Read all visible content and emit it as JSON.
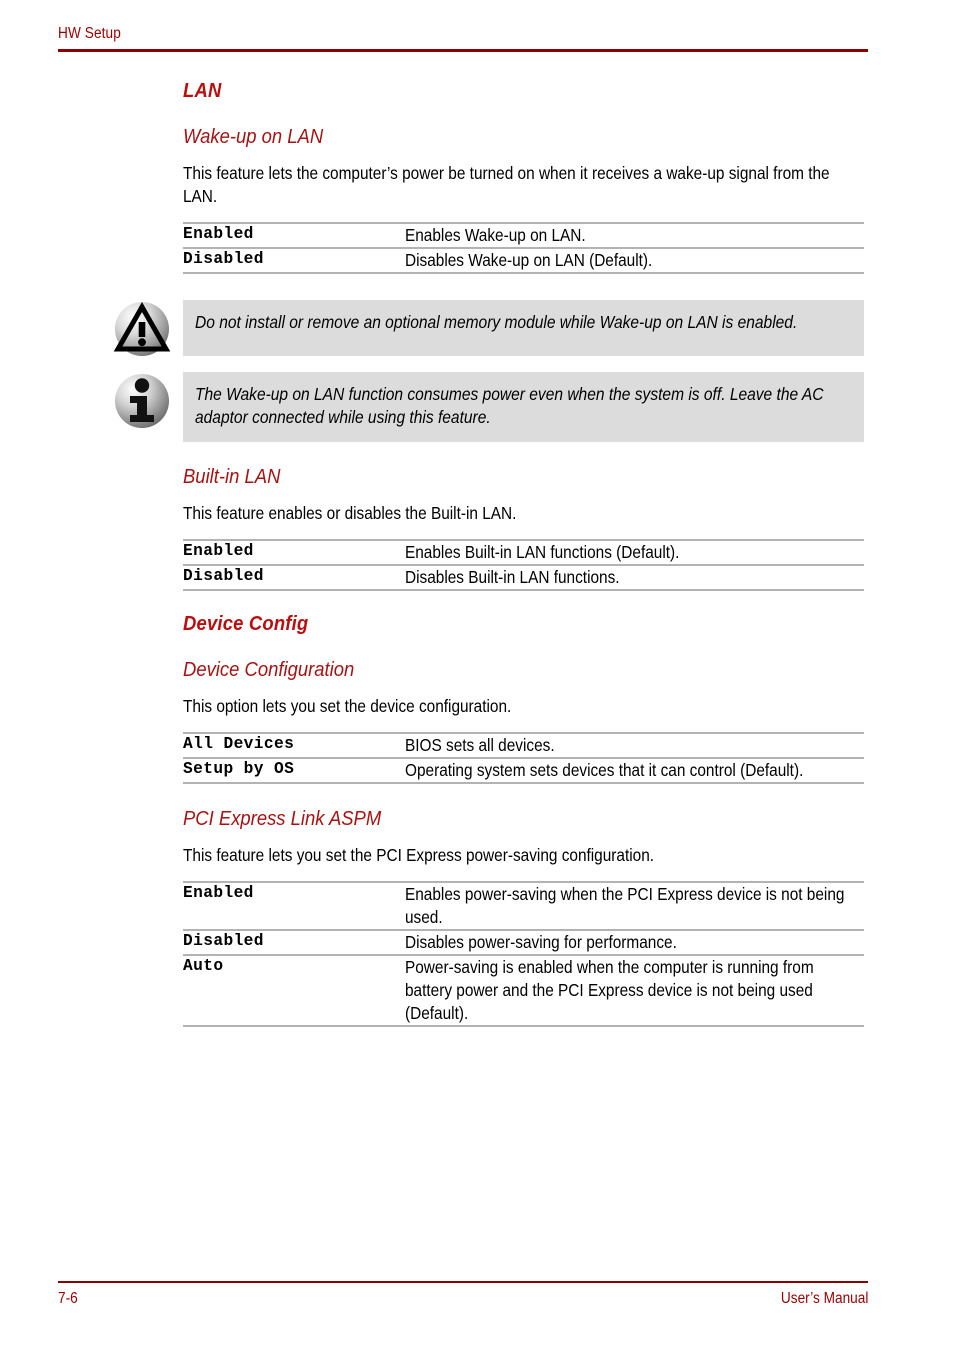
{
  "header": {
    "title": "HW Setup"
  },
  "footer": {
    "page_number": "7-6",
    "manual_label": "User’s Manual"
  },
  "colors": {
    "heading_red": "#bb0d0d",
    "subheading_red": "#a81212",
    "header_rule_red": "#8b0000",
    "running_head_red": "#990000",
    "note_background": "#dcdcdc",
    "table_rule_gray": "#b3b3b3"
  },
  "sections": [
    {
      "id": "lan",
      "heading": "LAN",
      "subsections": [
        {
          "id": "wake-up-on-lan",
          "subheading": "Wake-up on LAN",
          "intro": "This feature lets the computer’s power be turned on when it receives a wake-up signal from the LAN.",
          "rows": [
            {
              "term": "Enabled",
              "desc": "Enables Wake-up on LAN."
            },
            {
              "term": "Disabled",
              "desc": "Disables Wake-up on LAN (Default)."
            }
          ],
          "notes": [
            {
              "icon": "warning-triangle-icon",
              "text": "Do not install or remove an optional memory module while Wake-up on LAN is enabled."
            },
            {
              "icon": "info-i-icon",
              "text": "The Wake-up on LAN function consumes power even when the system is off. Leave the AC adaptor connected while using this feature."
            }
          ]
        },
        {
          "id": "built-in-lan",
          "subheading": "Built-in LAN",
          "intro": "This feature enables or disables the Built-in LAN.",
          "rows": [
            {
              "term": "Enabled",
              "desc": "Enables Built-in LAN functions (Default)."
            },
            {
              "term": "Disabled",
              "desc": "Disables Built-in LAN functions."
            }
          ],
          "notes": []
        }
      ]
    },
    {
      "id": "device-config",
      "heading": "Device Config",
      "subsections": [
        {
          "id": "device-configuration",
          "subheading": "Device Configuration",
          "intro": "This option lets you set the device configuration.",
          "rows": [
            {
              "term": "All Devices",
              "desc": "BIOS sets all devices."
            },
            {
              "term": "Setup by OS",
              "desc": "Operating system sets devices that it can control (Default)."
            }
          ],
          "notes": []
        },
        {
          "id": "pci-express-link-aspm",
          "subheading": "PCI Express Link ASPM",
          "intro": "This feature lets you set the PCI Express power-saving configuration.",
          "rows": [
            {
              "term": "Enabled",
              "desc": "Enables power-saving when the PCI Express device is not being used."
            },
            {
              "term": "Disabled",
              "desc": "Disables power-saving for performance."
            },
            {
              "term": "Auto",
              "desc": "Power-saving is enabled when the computer is running from battery power and the PCI Express device is not being used (Default)."
            }
          ],
          "notes": []
        }
      ]
    }
  ]
}
